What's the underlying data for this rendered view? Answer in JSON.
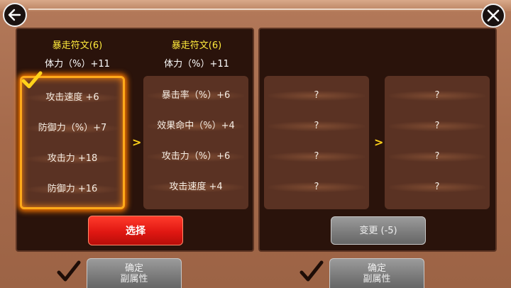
{
  "nav": {
    "back_icon": "arrow-left-icon",
    "close_icon": "close-x-icon"
  },
  "left": {
    "current": {
      "title": "暴走符文(6)",
      "stamina": "体力（%）+11",
      "stats": [
        "攻击速度 +6",
        "防御力（%）+7",
        "攻击力 +18",
        "防御力 +16"
      ]
    },
    "candidate": {
      "title": "暴走符文(6)",
      "stamina": "体力（%）+11",
      "stats": [
        "暴击率（%）+6",
        "效果命中（%）+4",
        "攻击力（%）+6",
        "攻击速度 +4"
      ]
    },
    "arrow": ">",
    "select_button": "选择",
    "confirm_button": {
      "line1": "确定",
      "line2": "副属性"
    }
  },
  "right": {
    "current": {
      "stats": [
        "?",
        "?",
        "?",
        "?"
      ]
    },
    "candidate": {
      "stats": [
        "?",
        "?",
        "?",
        "?"
      ]
    },
    "arrow": ">",
    "change_button": "变更 (-5)",
    "confirm_button": {
      "line1": "确定",
      "line2": "副属性"
    }
  },
  "colors": {
    "title_yellow": "#ffea3c",
    "select_red": "#e01712",
    "selection_glow": "#ffaa1a",
    "check": "#ffd21a"
  }
}
